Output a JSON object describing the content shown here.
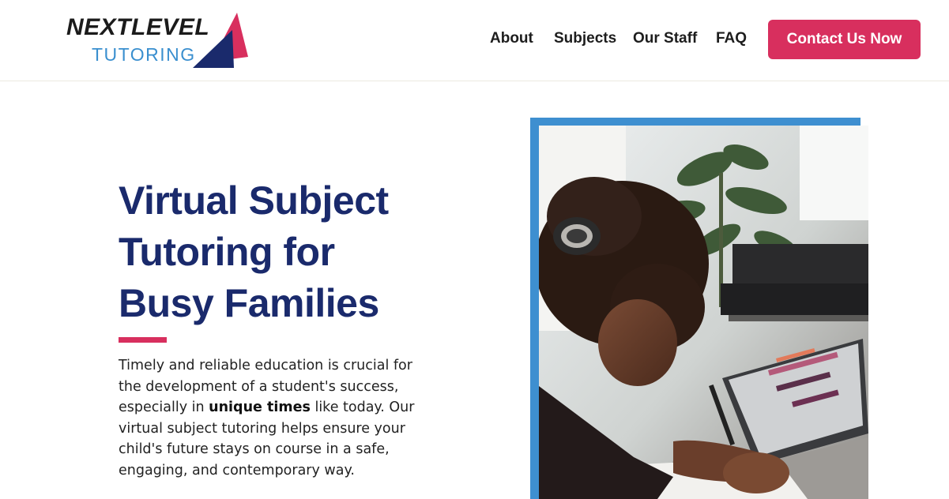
{
  "brand": {
    "line1": "NEXTLEVEL",
    "line2": "TUTORING",
    "colors": {
      "navy": "#1a2a6c",
      "pink": "#d82f5e",
      "blue": "#3e8fd0"
    }
  },
  "nav": {
    "items": [
      {
        "label": "About"
      },
      {
        "label": "Subjects"
      },
      {
        "label": "Our Staff"
      },
      {
        "label": "FAQ"
      }
    ],
    "cta_label": "Contact Us Now"
  },
  "hero": {
    "title_lines": [
      "Virtual Subject",
      "Tutoring for",
      "Busy Families"
    ],
    "body_before": "Timely and reliable education is crucial for the development of a student's success, especially in ",
    "body_bold": "unique times",
    "body_after": " like today. Our virtual subject tutoring helps ensure your child's future stays on course in a safe, engaging, and contemporary way."
  },
  "photo": {
    "icon": "photo-student-laptop-headphones"
  }
}
